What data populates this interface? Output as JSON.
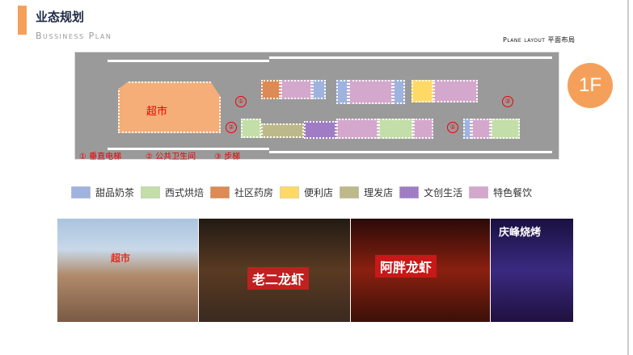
{
  "header": {
    "title": "业态规划",
    "subtitle": "Bussiness Plan",
    "plane_layout": "Plane layout 平面布局"
  },
  "floor": {
    "label": "1F",
    "supermarket": "超市",
    "markers": [
      {
        "num": "①",
        "label": "垂直电梯"
      },
      {
        "num": "②",
        "label": "公共卫生间"
      },
      {
        "num": "③",
        "label": "步梯"
      }
    ]
  },
  "colors": {
    "dessert": "#9fb3de",
    "western": "#c3dea8",
    "pharmacy": "#dd8a55",
    "convenience": "#ffd966",
    "barber": "#bdb98a",
    "creative": "#a07cc5",
    "special": "#d3a8cc",
    "supermarket": "#f5ae78"
  },
  "legend": [
    {
      "label": "甜品奶茶",
      "color": "#9fb3de"
    },
    {
      "label": "西式烘焙",
      "color": "#c3dea8"
    },
    {
      "label": "社区药房",
      "color": "#dd8a55"
    },
    {
      "label": "便利店",
      "color": "#ffd966"
    },
    {
      "label": "理发店",
      "color": "#bdb98a"
    },
    {
      "label": "文创生活",
      "color": "#a07cc5"
    },
    {
      "label": "特色餐饮",
      "color": "#d3a8cc"
    }
  ],
  "photos": [
    {
      "sign": "超市"
    },
    {
      "sign": "老二龙虾"
    },
    {
      "sign": "阿胖龙虾"
    },
    {
      "sign": "庆峰烧烤"
    }
  ]
}
